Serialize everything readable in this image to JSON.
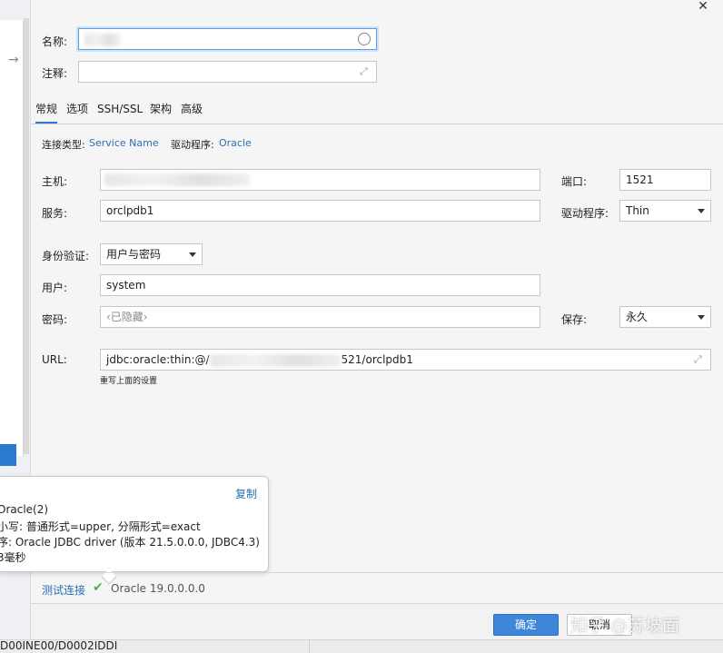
{
  "window": {
    "close_glyph": "✕"
  },
  "general": {
    "name_label": "名称:",
    "comment_label": "注释:"
  },
  "tabs": [
    {
      "label": "常规",
      "active": true
    },
    {
      "label": "选项",
      "active": false
    },
    {
      "label": "SSH/SSL",
      "active": false
    },
    {
      "label": "架构",
      "active": false
    },
    {
      "label": "高级",
      "active": false
    }
  ],
  "connection": {
    "type_label": "连接类型:",
    "type_value": "Service Name",
    "driver_label": "驱动程序:",
    "driver_value": "Oracle"
  },
  "form": {
    "host_label": "主机:",
    "port_label": "端口:",
    "port_value": "1521",
    "service_label": "服务:",
    "service_value": "orclpdb1",
    "driver_label": "驱动程序:",
    "driver_value": "Thin",
    "auth_label": "身份验证:",
    "auth_value": "用户与密码",
    "user_label": "用户:",
    "user_value": "system",
    "password_label": "密码:",
    "password_placeholder": "‹已隐藏›",
    "save_label": "保存:",
    "save_value": "永久",
    "url_label": "URL:",
    "url_prefix": "jdbc:oracle:thin:@/",
    "url_suffix": "521/orclpdb1",
    "url_hint": "重写上面的设置"
  },
  "tooltip": {
    "copy_label": "复制",
    "lines": [
      "Oracle(2)",
      "小写: 普通形式=upper, 分隔形式=exact",
      "序: Oracle JDBC driver (版本 21.5.0.0.0, JDBC4.3)",
      "3毫秒"
    ]
  },
  "footer": {
    "test_connection_label": "测试连接",
    "status_text": "Oracle 19.0.0.0.0",
    "ok_label": "确定",
    "cancel_label": "取消",
    "watermark": "知乎 @苏坡面"
  },
  "bottom_strip": {
    "text": "D00INE00/D0002IDDI"
  },
  "colors": {
    "accent": "#2a7ad0",
    "link": "#2a6fb6",
    "ok_button": "#3d86d8",
    "success": "#4caf50"
  }
}
